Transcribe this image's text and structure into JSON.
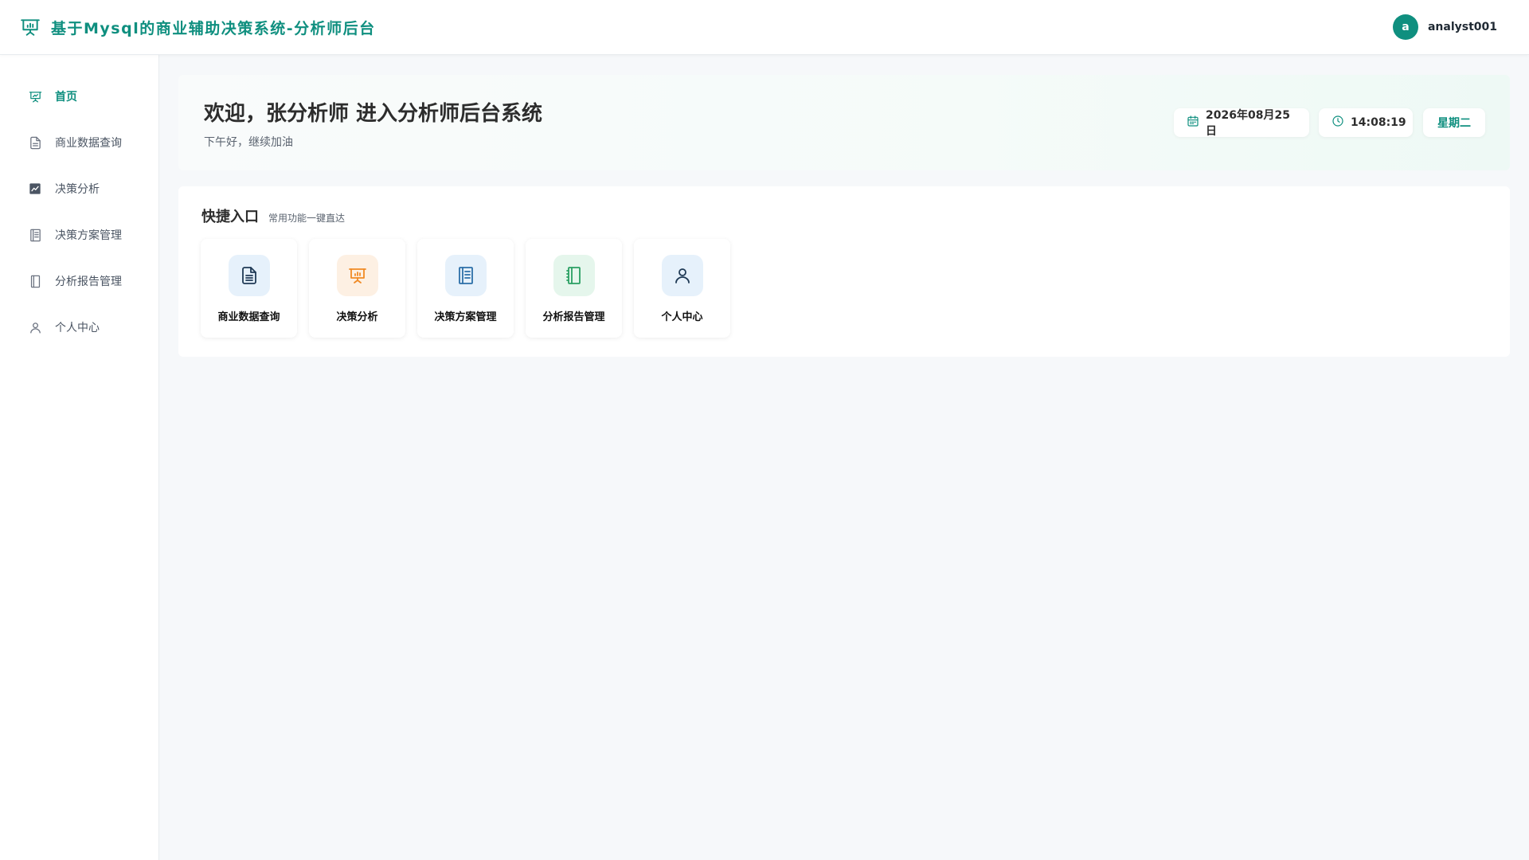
{
  "header": {
    "title": "基于Mysql的商业辅助决策系统-分析师后台",
    "brand_icon": "presentation-chart-icon",
    "avatar_letter": "a",
    "username": "analyst001",
    "accent": "#0f8f7f"
  },
  "sidebar": {
    "items": [
      {
        "label": "首页",
        "icon": "presentation-chart-icon",
        "active": true
      },
      {
        "label": "商业数据查询",
        "icon": "document-icon",
        "active": false
      },
      {
        "label": "决策分析",
        "icon": "line-chart-icon",
        "active": false
      },
      {
        "label": "决策方案管理",
        "icon": "list-book-icon",
        "active": false
      },
      {
        "label": "分析报告管理",
        "icon": "notebook-icon",
        "active": false
      },
      {
        "label": "个人中心",
        "icon": "user-icon",
        "active": false
      }
    ]
  },
  "welcome": {
    "title": "欢迎，张分析师 进入分析师后台系统",
    "subtitle": "下午好，继续加油",
    "date": "2026年08月25日",
    "time": "14:08:19",
    "weekday": "星期二"
  },
  "quick": {
    "title": "快捷入口",
    "subtitle": "常用功能一键直达",
    "items": [
      {
        "label": "商业数据查询",
        "icon": "document-icon",
        "bg": "#e6f1fb",
        "color": "#1f3a55"
      },
      {
        "label": "决策分析",
        "icon": "presentation-chart-icon",
        "bg": "#fdf0e3",
        "color": "#f08a24"
      },
      {
        "label": "决策方案管理",
        "icon": "list-book-icon",
        "bg": "#e6f1fb",
        "color": "#2c6fa8"
      },
      {
        "label": "分析报告管理",
        "icon": "notebook-icon",
        "bg": "#e5f6ec",
        "color": "#2aa063"
      },
      {
        "label": "个人中心",
        "icon": "user-icon",
        "bg": "#e6f1fb",
        "color": "#1f3a55"
      }
    ]
  }
}
